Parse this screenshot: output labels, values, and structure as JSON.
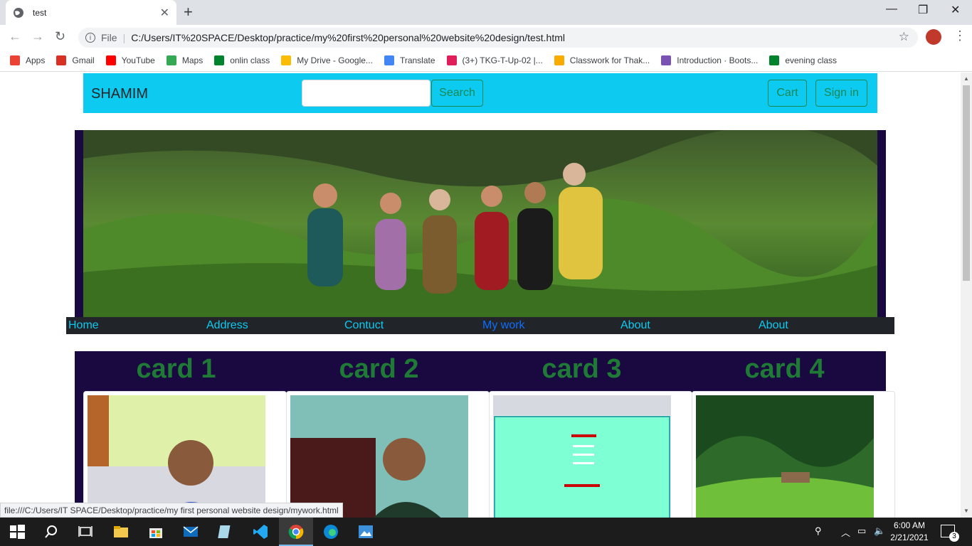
{
  "browser": {
    "tab_title": "test",
    "url_scheme": "File",
    "url": "C:/Users/IT%20SPACE/Desktop/practice/my%20first%20personal%20website%20design/test.html",
    "bookmarks": [
      {
        "label": "Apps",
        "color": "#ea4335"
      },
      {
        "label": "Gmail",
        "color": "#d93025"
      },
      {
        "label": "YouTube",
        "color": "#ff0000"
      },
      {
        "label": "Maps",
        "color": "#34a853"
      },
      {
        "label": "onlin class",
        "color": "#00832d"
      },
      {
        "label": "My Drive - Google...",
        "color": "#fbbc04"
      },
      {
        "label": "Translate",
        "color": "#4285f4"
      },
      {
        "label": "(3+) TKG-T-Up-02 |...",
        "color": "#e01e5a"
      },
      {
        "label": "Classwork for Thak...",
        "color": "#f9ab00"
      },
      {
        "label": "Introduction · Boots...",
        "color": "#7952b3"
      },
      {
        "label": "evening class",
        "color": "#00832d"
      }
    ],
    "status_url": "file:///C:/Users/IT SPACE/Desktop/practice/my first personal website design/mywork.html"
  },
  "site": {
    "brand": "SHAMIM",
    "search_button": "Search",
    "cart_button": "Cart",
    "signin_button": "Sign in",
    "nav_links": [
      "Home",
      "Address",
      "Contuct",
      "My work",
      "About",
      "About"
    ],
    "active_link": "My work",
    "card_titles": [
      "card 1",
      "card 2",
      "card 3",
      "card 4"
    ]
  },
  "taskbar": {
    "time": "6:00 AM",
    "date": "2/21/2021",
    "notifications": "3"
  },
  "colors": {
    "navbar": "#0dcaf0",
    "hero_bg": "#1a0840",
    "link": "#0dcaf0",
    "card_title": "#1f7a35"
  }
}
